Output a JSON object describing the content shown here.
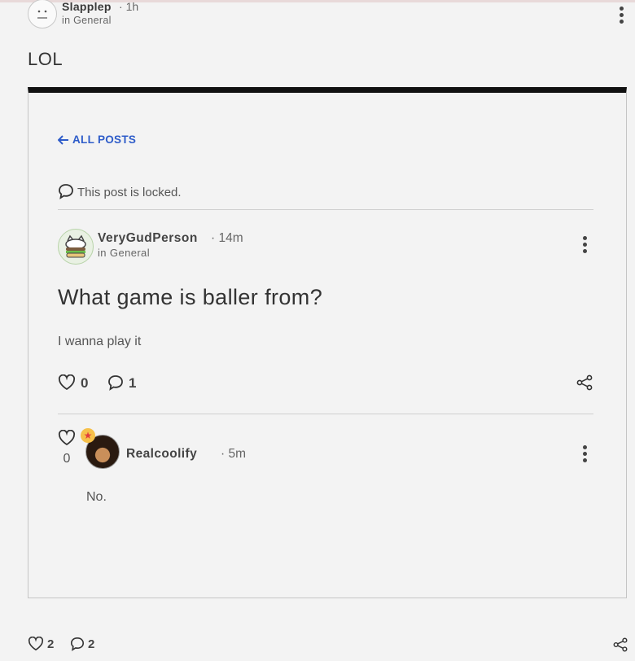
{
  "outer_post": {
    "author": "Slapplep",
    "time": "1h",
    "category": "in General",
    "text": "LOL",
    "likes": "2",
    "comments": "2"
  },
  "embed": {
    "back_label": "ALL POSTS",
    "locked_text": "This post is locked.",
    "post": {
      "author": "VeryGudPerson",
      "time": "14m",
      "category": "in General",
      "title": "What game is baller from?",
      "body": "I wanna play it",
      "likes": "0",
      "comments": "1"
    },
    "comment": {
      "likes": "0",
      "author": "Realcoolify",
      "time": "5m",
      "body": "No."
    }
  },
  "colors": {
    "link": "#2e5cc9",
    "embed_border_top": "#111111"
  }
}
